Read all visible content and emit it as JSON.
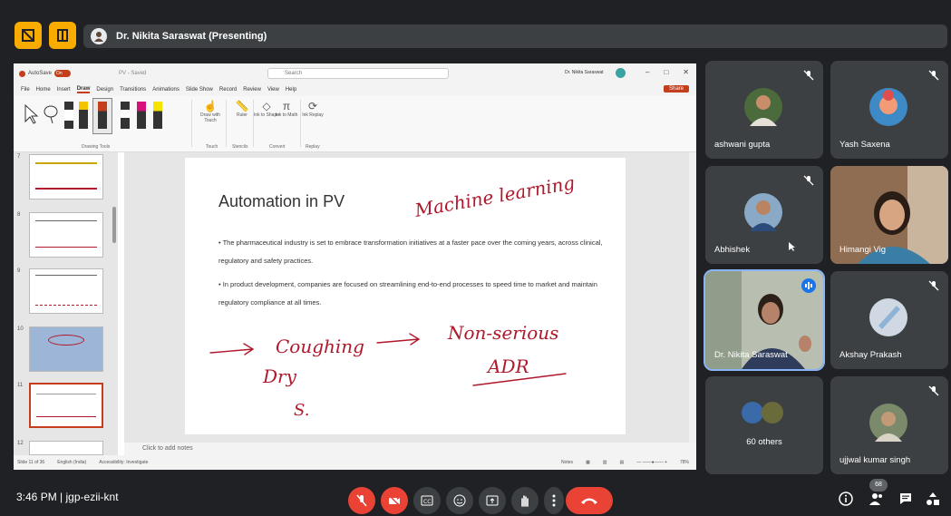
{
  "meeting": {
    "presenter_label": "Dr. Nikita Saraswat (Presenting)",
    "time": "3:46 PM",
    "separator": "|",
    "code": "jgp-ezii-knt",
    "participant_count_badge": "68"
  },
  "ppt": {
    "autosave_label": "AutoSave",
    "toggle_state": "On",
    "file_name": "PV - Saved",
    "search_placeholder": "Search",
    "user": "Dr. Nikita Saraswat",
    "menu": [
      "File",
      "Home",
      "Insert",
      "Draw",
      "Design",
      "Transitions",
      "Animations",
      "Slide Show",
      "Record",
      "Review",
      "View",
      "Help"
    ],
    "active_menu": "Draw",
    "share_label": "Share",
    "ribbon_groups": [
      "Drawing Tools",
      "Touch",
      "Stencils",
      "Convert",
      "Replay"
    ],
    "ribbon_tools": [
      "Draw with Touch",
      "Ruler",
      "Ink to Shape",
      "Ink to Math",
      "Ink Replay"
    ],
    "slide_numbers": [
      "7",
      "8",
      "9",
      "10",
      "11",
      "12"
    ],
    "slide_title": "Automation in PV",
    "bullets": [
      "The pharmaceutical industry is set to embrace transformation initiatives at a faster pace over the coming years, across clinical, regulatory and safety practices.",
      "In product development, companies are focused on streamlining end-to-end processes to speed time to market and maintain regulatory compliance at all times."
    ],
    "ink_text": [
      "Machine learning",
      "Coughing",
      "Non-serious",
      "Dry",
      "ADR",
      "S."
    ],
    "notes_placeholder": "Click to add notes",
    "status": {
      "slide_of": "Slide 11 of 36",
      "language": "English (India)",
      "accessibility": "Accessibility: Investigate",
      "notes": "Notes",
      "zoom": "78%"
    }
  },
  "participants": [
    {
      "name": "ashwani gupta",
      "muted": true
    },
    {
      "name": "Yash Saxena",
      "muted": true
    },
    {
      "name": "Abhishek",
      "muted": true
    },
    {
      "name": "Himangi Vig",
      "muted": true
    },
    {
      "name": "Dr. Nikita Saraswat",
      "muted": false,
      "speaking": true
    },
    {
      "name": "Akshay Prakash",
      "muted": true
    },
    {
      "name": "60 others",
      "muted": false
    },
    {
      "name": "ujjwal kumar singh",
      "muted": true
    }
  ],
  "colors": {
    "accent_blue": "#8ab4f8",
    "meet_red": "#ea4335",
    "ppt_red": "#c43e1c",
    "ink_red": "#b0182c",
    "yellow": "#f9ab00"
  },
  "icons": [
    "mic-off-icon",
    "camera-off-icon",
    "captions-icon",
    "emoji-icon",
    "present-icon",
    "raise-hand-icon",
    "more-icon",
    "end-call-icon",
    "info-icon",
    "people-icon",
    "chat-icon",
    "activities-icon"
  ]
}
